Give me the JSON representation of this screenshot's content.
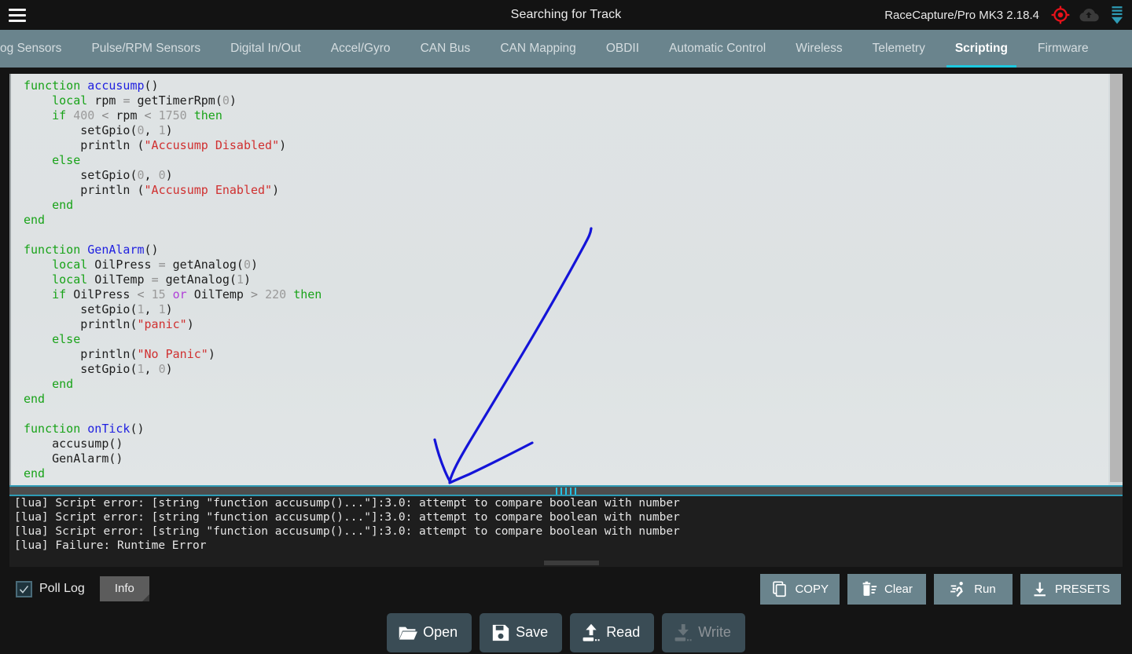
{
  "topbar": {
    "menu_icon": "hamburger-menu-icon",
    "title": "Searching for Track",
    "device": "RaceCapture/Pro MK3 2.18.4",
    "icons": [
      {
        "name": "gps-target-icon",
        "color": "#e8121a"
      },
      {
        "name": "cloud-upload-icon",
        "color": "#3a3a3a"
      },
      {
        "name": "download-stack-icon",
        "color": "#2e9bb5"
      }
    ]
  },
  "tabs": [
    {
      "label": "Analog Sensors",
      "active": false
    },
    {
      "label": "Pulse/RPM Sensors",
      "active": false
    },
    {
      "label": "Digital In/Out",
      "active": false
    },
    {
      "label": "Accel/Gyro",
      "active": false
    },
    {
      "label": "CAN Bus",
      "active": false
    },
    {
      "label": "CAN Mapping",
      "active": false
    },
    {
      "label": "OBDII",
      "active": false
    },
    {
      "label": "Automatic Control",
      "active": false
    },
    {
      "label": "Wireless",
      "active": false
    },
    {
      "label": "Telemetry",
      "active": false
    },
    {
      "label": "Scripting",
      "active": true
    },
    {
      "label": "Firmware",
      "active": false
    }
  ],
  "editor": {
    "language": "lua",
    "code_lines": [
      [
        {
          "t": "function ",
          "c": "kw"
        },
        {
          "t": "accusump",
          "c": "fn"
        },
        {
          "t": "()",
          "c": ""
        }
      ],
      [
        {
          "t": "    ",
          "c": ""
        },
        {
          "t": "local",
          "c": "kw"
        },
        {
          "t": " rpm ",
          "c": ""
        },
        {
          "t": "=",
          "c": "op"
        },
        {
          "t": " getTimerRpm(",
          "c": ""
        },
        {
          "t": "0",
          "c": "num"
        },
        {
          "t": ")",
          "c": ""
        }
      ],
      [
        {
          "t": "    ",
          "c": ""
        },
        {
          "t": "if",
          "c": "kw"
        },
        {
          "t": " ",
          "c": ""
        },
        {
          "t": "400",
          "c": "num"
        },
        {
          "t": " ",
          "c": ""
        },
        {
          "t": "<",
          "c": "op"
        },
        {
          "t": " rpm ",
          "c": ""
        },
        {
          "t": "<",
          "c": "op"
        },
        {
          "t": " ",
          "c": ""
        },
        {
          "t": "1750",
          "c": "num"
        },
        {
          "t": " ",
          "c": ""
        },
        {
          "t": "then",
          "c": "kw"
        }
      ],
      [
        {
          "t": "        setGpio(",
          "c": ""
        },
        {
          "t": "0",
          "c": "num"
        },
        {
          "t": ", ",
          "c": ""
        },
        {
          "t": "1",
          "c": "num"
        },
        {
          "t": ")",
          "c": ""
        }
      ],
      [
        {
          "t": "        println (",
          "c": ""
        },
        {
          "t": "\"Accusump Disabled\"",
          "c": "str"
        },
        {
          "t": ")",
          "c": ""
        }
      ],
      [
        {
          "t": "    ",
          "c": ""
        },
        {
          "t": "else",
          "c": "kw"
        }
      ],
      [
        {
          "t": "        setGpio(",
          "c": ""
        },
        {
          "t": "0",
          "c": "num"
        },
        {
          "t": ", ",
          "c": ""
        },
        {
          "t": "0",
          "c": "num"
        },
        {
          "t": ")",
          "c": ""
        }
      ],
      [
        {
          "t": "        println (",
          "c": ""
        },
        {
          "t": "\"Accusump Enabled\"",
          "c": "str"
        },
        {
          "t": ")",
          "c": ""
        }
      ],
      [
        {
          "t": "    ",
          "c": ""
        },
        {
          "t": "end",
          "c": "kw"
        }
      ],
      [
        {
          "t": "end",
          "c": "kw"
        }
      ],
      [
        {
          "t": "",
          "c": ""
        }
      ],
      [
        {
          "t": "function ",
          "c": "kw"
        },
        {
          "t": "GenAlarm",
          "c": "fn"
        },
        {
          "t": "()",
          "c": ""
        }
      ],
      [
        {
          "t": "    ",
          "c": ""
        },
        {
          "t": "local",
          "c": "kw"
        },
        {
          "t": " OilPress ",
          "c": ""
        },
        {
          "t": "=",
          "c": "op"
        },
        {
          "t": " getAnalog(",
          "c": ""
        },
        {
          "t": "0",
          "c": "num"
        },
        {
          "t": ")",
          "c": ""
        }
      ],
      [
        {
          "t": "    ",
          "c": ""
        },
        {
          "t": "local",
          "c": "kw"
        },
        {
          "t": " OilTemp ",
          "c": ""
        },
        {
          "t": "=",
          "c": "op"
        },
        {
          "t": " getAnalog(",
          "c": ""
        },
        {
          "t": "1",
          "c": "num"
        },
        {
          "t": ")",
          "c": ""
        }
      ],
      [
        {
          "t": "    ",
          "c": ""
        },
        {
          "t": "if",
          "c": "kw"
        },
        {
          "t": " OilPress ",
          "c": ""
        },
        {
          "t": "<",
          "c": "op"
        },
        {
          "t": " ",
          "c": ""
        },
        {
          "t": "15",
          "c": "num"
        },
        {
          "t": " ",
          "c": ""
        },
        {
          "t": "or",
          "c": "orkw"
        },
        {
          "t": " OilTemp ",
          "c": ""
        },
        {
          "t": ">",
          "c": "op"
        },
        {
          "t": " ",
          "c": ""
        },
        {
          "t": "220",
          "c": "num"
        },
        {
          "t": " ",
          "c": ""
        },
        {
          "t": "then",
          "c": "kw"
        }
      ],
      [
        {
          "t": "        setGpio(",
          "c": ""
        },
        {
          "t": "1",
          "c": "num"
        },
        {
          "t": ", ",
          "c": ""
        },
        {
          "t": "1",
          "c": "num"
        },
        {
          "t": ")",
          "c": ""
        }
      ],
      [
        {
          "t": "        println(",
          "c": ""
        },
        {
          "t": "\"panic\"",
          "c": "str"
        },
        {
          "t": ")",
          "c": ""
        }
      ],
      [
        {
          "t": "    ",
          "c": ""
        },
        {
          "t": "else",
          "c": "kw"
        }
      ],
      [
        {
          "t": "        println(",
          "c": ""
        },
        {
          "t": "\"No Panic\"",
          "c": "str"
        },
        {
          "t": ")",
          "c": ""
        }
      ],
      [
        {
          "t": "        setGpio(",
          "c": ""
        },
        {
          "t": "1",
          "c": "num"
        },
        {
          "t": ", ",
          "c": ""
        },
        {
          "t": "0",
          "c": "num"
        },
        {
          "t": ")",
          "c": ""
        }
      ],
      [
        {
          "t": "    ",
          "c": ""
        },
        {
          "t": "end",
          "c": "kw"
        }
      ],
      [
        {
          "t": "end",
          "c": "kw"
        }
      ],
      [
        {
          "t": "",
          "c": ""
        }
      ],
      [
        {
          "t": "function ",
          "c": "kw"
        },
        {
          "t": "onTick",
          "c": "fn"
        },
        {
          "t": "()",
          "c": ""
        }
      ],
      [
        {
          "t": "    accusump()",
          "c": ""
        }
      ],
      [
        {
          "t": "    GenAlarm()",
          "c": ""
        }
      ],
      [
        {
          "t": "end",
          "c": "kw"
        }
      ]
    ]
  },
  "log": {
    "lines": [
      "[lua] Script error: [string \"function accusump()...\"]:3.0: attempt to compare boolean with number",
      "[lua] Script error: [string \"function accusump()...\"]:3.0: attempt to compare boolean with number",
      "[lua] Script error: [string \"function accusump()...\"]:3.0: attempt to compare boolean with number",
      "[lua] Failure: Runtime Error"
    ]
  },
  "actionbar": {
    "poll_log_label": "Poll Log",
    "poll_log_checked": true,
    "info_label": "Info",
    "buttons": [
      {
        "label": "COPY",
        "icon": "copy-icon"
      },
      {
        "label": "Clear",
        "icon": "delete-sweep-icon"
      },
      {
        "label": "Run",
        "icon": "run-person-icon"
      },
      {
        "label": "PRESETS",
        "icon": "download-icon"
      }
    ]
  },
  "filebar": {
    "buttons": [
      {
        "label": "Open",
        "icon": "folder-open-icon",
        "disabled": false
      },
      {
        "label": "Save",
        "icon": "floppy-save-icon",
        "disabled": false
      },
      {
        "label": "Read",
        "icon": "upload-device-icon",
        "disabled": false
      },
      {
        "label": "Write",
        "icon": "write-device-icon",
        "disabled": true
      }
    ]
  },
  "annotation": {
    "name": "blue-hand-drawn-arrow",
    "color": "#1414d8"
  },
  "theme": {
    "topbar_bg": "#131313",
    "tabbar_bg": "#6a848d",
    "accent_cyan": "#1ec8e0",
    "editor_bg": "#dfe3e4",
    "log_bg": "#1e1e1e",
    "button_bg": "#6a848d",
    "file_button_bg": "#3a4c55"
  }
}
